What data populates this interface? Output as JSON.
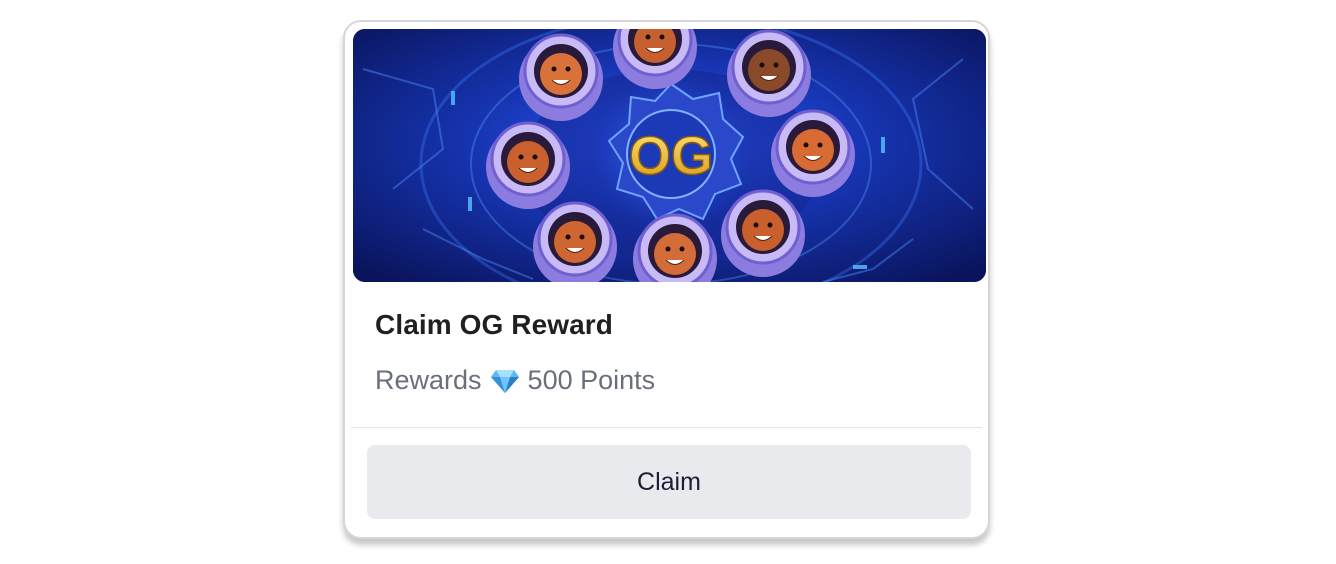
{
  "card": {
    "banner": {
      "badge_text": "OG",
      "colors": {
        "background": "#0c1a6e",
        "glow": "#2a66ff",
        "badge_gold": "#e8b923",
        "suit": "#b9a7f0"
      }
    },
    "title": "Claim OG Reward",
    "rewards": {
      "label": "Rewards",
      "icon": "diamond-icon",
      "amount": "500 Points"
    },
    "button": {
      "label": "Claim"
    }
  }
}
